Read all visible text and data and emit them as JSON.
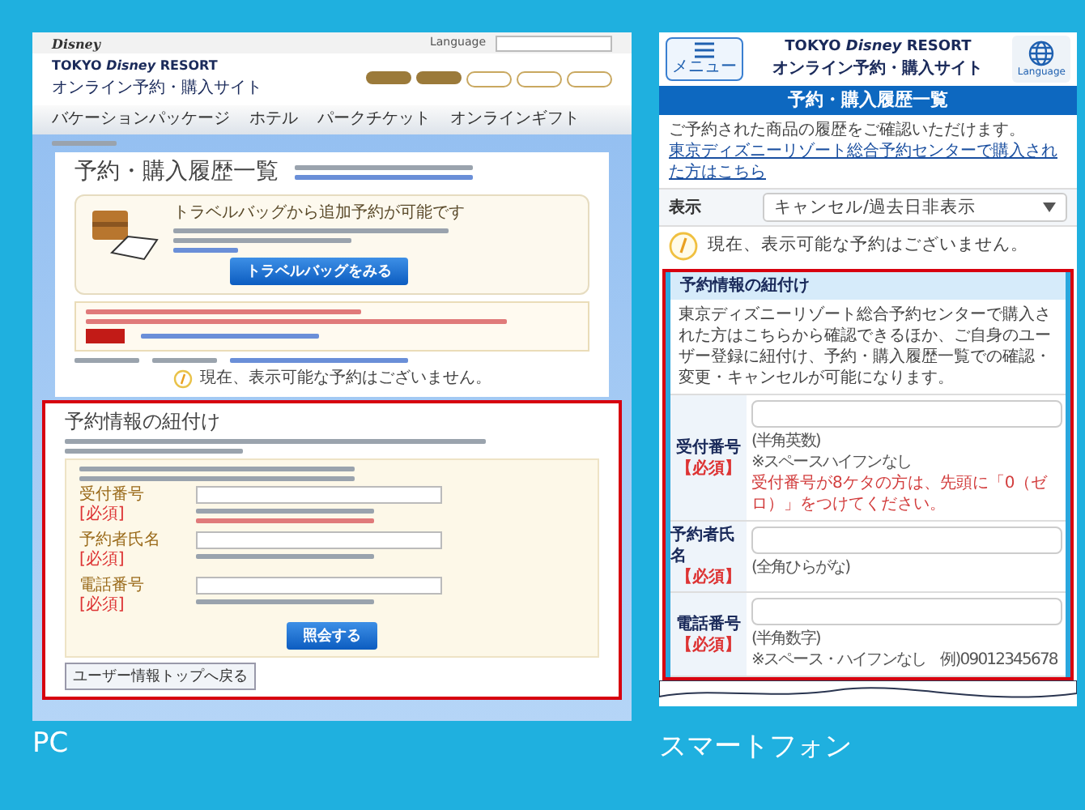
{
  "pc": {
    "label": "PC",
    "header": {
      "brand": "Disney",
      "language": "Language",
      "logo": "TOKYO *Disney* RESORT",
      "site_name": "オンライン予約・購入サイト"
    },
    "nav": [
      "バケーションパッケージ",
      "ホテル",
      "パークチケット",
      "オンラインギフト"
    ],
    "page_title": "予約・購入履歴一覧",
    "travel_bag": {
      "heading": "トラベルバッグから追加予約が可能です",
      "button": "トラベルバッグをみる"
    },
    "empty_message": "現在、表示可能な予約はございません。",
    "link_section": {
      "title": "予約情報の紐付け",
      "fields": [
        {
          "label": "受付番号",
          "required": "[必須]"
        },
        {
          "label": "予約者氏名",
          "required": "[必須]"
        },
        {
          "label": "電話番号",
          "required": "[必須]"
        }
      ],
      "submit": "照会する",
      "back": "ユーザー情報トップへ戻る"
    }
  },
  "phone": {
    "label": "スマートフォン",
    "menu_button": "メニュー",
    "logo": "TOKYO *Disney* RESORT",
    "site_name": "オンライン予約・購入サイト",
    "language_button": "Language",
    "title": "予約・購入履歴一覧",
    "intro": "ご予約された商品の履歴をご確認いただけます。",
    "link": "東京ディズニーリゾート総合予約センターで購入された方はこちら",
    "filter": {
      "label": "表示",
      "value": "キャンセル/過去日非表示"
    },
    "empty_message": "現在、表示可能な予約はございません。",
    "link_section": {
      "title": "予約情報の紐付け",
      "description": "東京ディズニーリゾート総合予約センターで購入された方はこちらから確認できるほか、ご自身のユーザー登録に紐付け、予約・購入履歴一覧での確認・変更・キャンセルが可能になります。",
      "fields": [
        {
          "label": "受付番号",
          "required": "【必須】",
          "notes": [
            {
              "kind": "hint",
              "text": "(半角英数)"
            },
            {
              "kind": "hint",
              "text": "※スペースハイフンなし"
            },
            {
              "kind": "warning",
              "text": "受付番号が8ケタの方は、先頭に「0（ゼロ）」をつけてください。"
            }
          ]
        },
        {
          "label": "予約者氏名",
          "required": "【必須】",
          "notes": [
            {
              "kind": "hint",
              "text": "(全角ひらがな)"
            }
          ]
        },
        {
          "label": "電話番号",
          "required": "【必須】",
          "notes": [
            {
              "kind": "hint",
              "text": "(半角数字)"
            },
            {
              "kind": "hint",
              "text": "※スペース・ハイフンなし　例)09012345678"
            }
          ]
        }
      ]
    }
  }
}
